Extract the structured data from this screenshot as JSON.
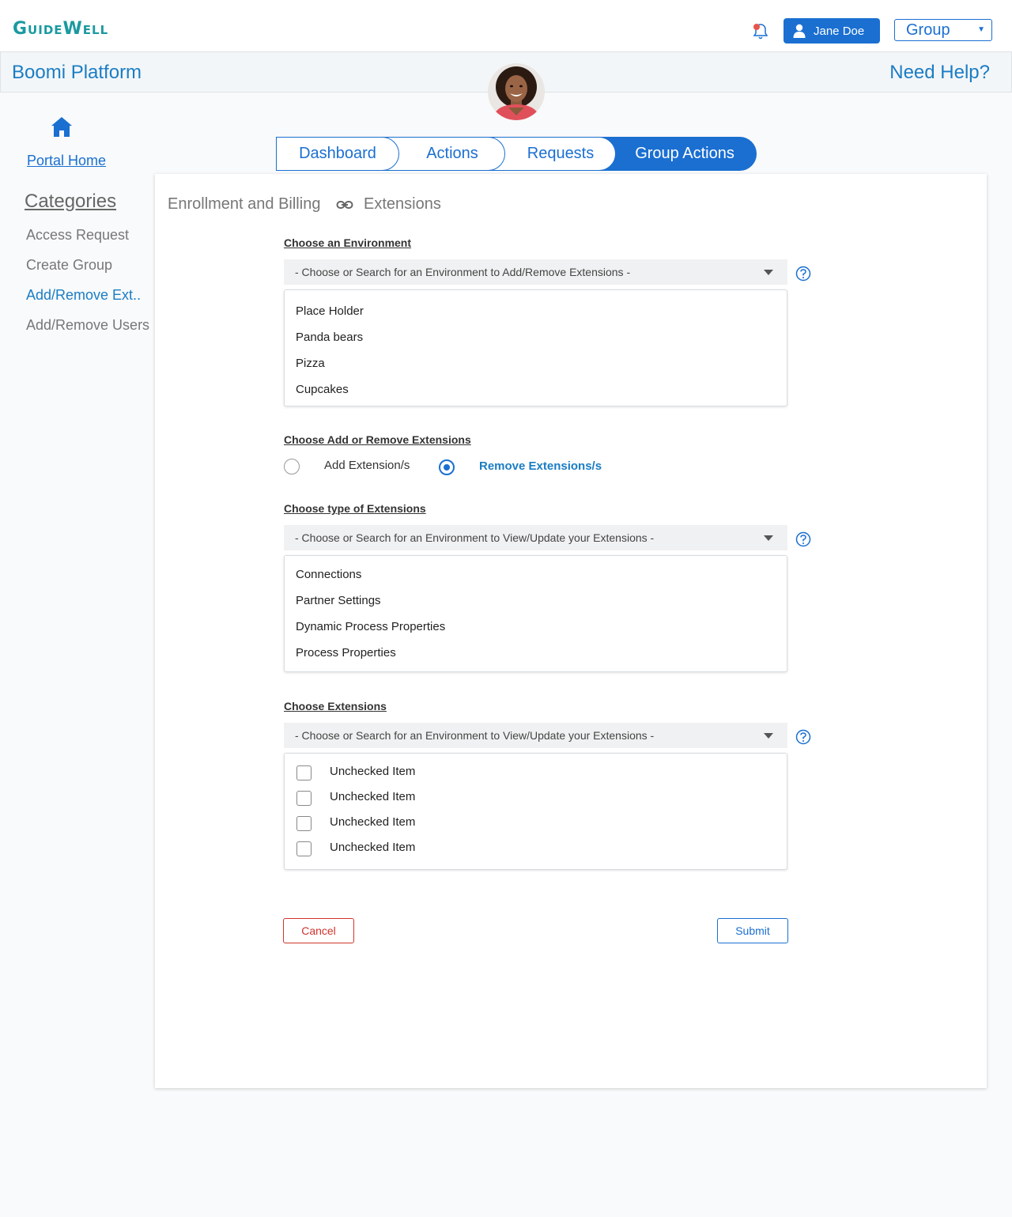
{
  "header": {
    "logo_text": "GuideWell",
    "user_name": "Jane Doe",
    "group_select_value": "Group"
  },
  "subheader": {
    "title": "Boomi Platform",
    "help_link": "Need Help?"
  },
  "sidebar": {
    "portal_home": "Portal Home",
    "categories_heading": "Categories",
    "items": [
      {
        "label": "Access Request"
      },
      {
        "label": "Create Group"
      },
      {
        "label": "Add/Remove Ext.."
      },
      {
        "label": "Add/Remove Users"
      }
    ]
  },
  "tabs": [
    {
      "label": "Dashboard"
    },
    {
      "label": "Actions"
    },
    {
      "label": "Requests"
    },
    {
      "label": "Group Actions"
    }
  ],
  "breadcrumb": {
    "parent": "Enrollment and Billing",
    "current": "Extensions"
  },
  "environment": {
    "label": "Choose an Environment",
    "placeholder": "- Choose or Search for an Environment to Add/Remove Extensions -",
    "options": [
      "Place Holder",
      "Panda bears",
      "Pizza",
      "Cupcakes"
    ]
  },
  "add_remove": {
    "label": "Choose Add or Remove Extensions",
    "add_label": "Add Extension/s",
    "remove_label": "Remove Extensions/s",
    "selected": "remove"
  },
  "ext_type": {
    "label": "Choose type of Extensions",
    "placeholder": "- Choose or Search for an Environment to View/Update your Extensions -",
    "options": [
      "Connections",
      "Partner Settings",
      "Dynamic Process Properties",
      "Process Properties"
    ]
  },
  "extensions": {
    "label": "Choose  Extensions",
    "placeholder": "- Choose or Search for an Environment to View/Update your Extensions -",
    "items": [
      "Unchecked Item",
      "Unchecked Item",
      "Unchecked Item",
      "Unchecked Item"
    ]
  },
  "buttons": {
    "cancel": "Cancel",
    "submit": "Submit"
  },
  "colors": {
    "brand_blue": "#1a6fd1",
    "link_blue": "#1a7dc4",
    "logo_teal": "#1a9aa0",
    "cancel_red": "#d0342c"
  }
}
